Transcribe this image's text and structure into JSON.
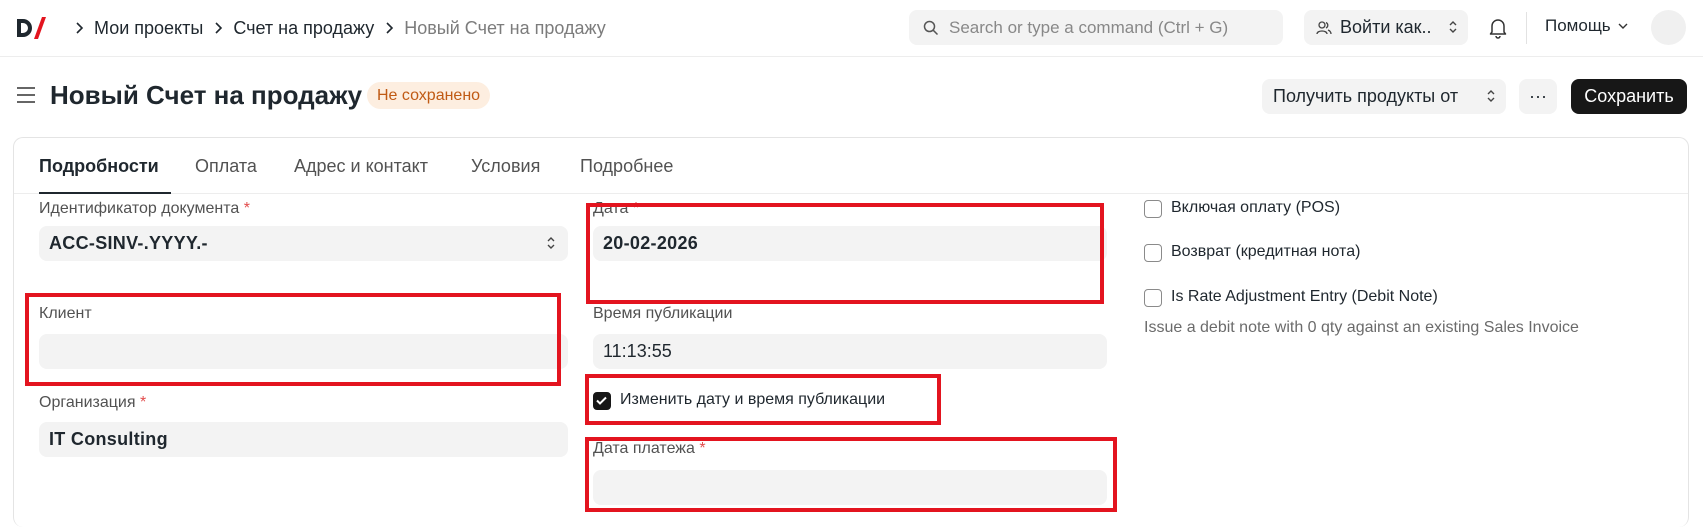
{
  "breadcrumbs": [
    "Мои проекты",
    "Счет на продажу",
    "Новый Счет на продажу"
  ],
  "search": {
    "placeholder": "Search or type a command (Ctrl + G)"
  },
  "impersonate_label": "Войти как..",
  "help_label": "Помощь",
  "page": {
    "title": "Новый Счет на продажу",
    "status": "Не сохранено",
    "get_items_label": "Получить продукты от",
    "more_label": "···",
    "save_label": "Сохранить"
  },
  "tabs": [
    "Подробности",
    "Оплата",
    "Адрес и контакт",
    "Условия",
    "Подробнее"
  ],
  "form": {
    "naming_series": {
      "label": "Идентификатор документа",
      "required": "*",
      "value": "ACC-SINV-.YYYY.-"
    },
    "customer": {
      "label": "Клиент",
      "value": ""
    },
    "company": {
      "label": "Организация",
      "required": "*",
      "value": "IT Consulting"
    },
    "posting_date": {
      "label": "Дата",
      "required": "*",
      "value": "20-02-2026"
    },
    "posting_time": {
      "label": "Время публикации",
      "value": "11:13:55"
    },
    "set_posting_time": {
      "label": "Изменить дату и время публикации",
      "checked": true
    },
    "due_date": {
      "label": "Дата платежа",
      "required": "*",
      "value": ""
    },
    "is_pos": {
      "label": "Включая оплату (POS)",
      "checked": false
    },
    "is_return": {
      "label": "Возврат (кредитная нота)",
      "checked": false
    },
    "is_debit_note": {
      "label": "Is Rate Adjustment Entry (Debit Note)",
      "checked": false,
      "description": "Issue a debit note with 0 qty against an existing Sales Invoice"
    }
  },
  "colors": {
    "highlight": "#e3141f",
    "primary_button": "#171717",
    "badge_bg": "#fdeee0",
    "badge_text": "#c05a14"
  }
}
